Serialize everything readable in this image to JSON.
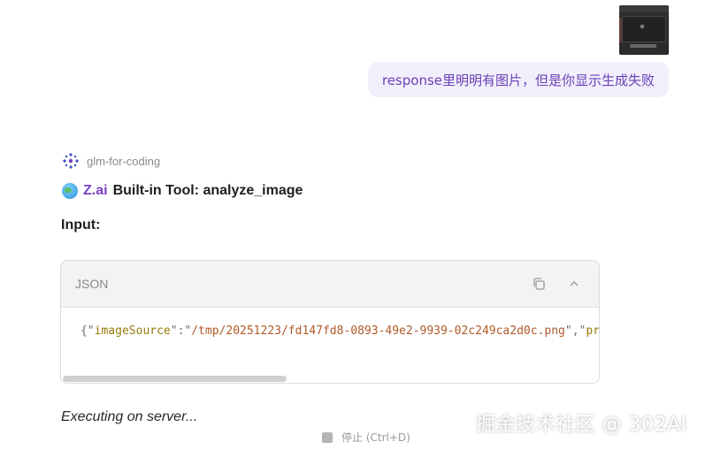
{
  "user_message": {
    "text": "response里明明有图片，但是你显示生成失败"
  },
  "assistant": {
    "model_name": "glm-for-coding",
    "tool_brand": "Z.ai",
    "tool_title": "Built-in Tool: analyze_image",
    "input_label": "Input:",
    "code_block": {
      "language": "JSON",
      "tokens": [
        {
          "t": "{\"",
          "c": "p"
        },
        {
          "t": "imageSource",
          "c": "k"
        },
        {
          "t": "\":\"",
          "c": "p"
        },
        {
          "t": "/tmp/20251223/fd147fd8-0893-49e2-9939-02c249ca2d0c.png",
          "c": "s"
        },
        {
          "t": "\",\"",
          "c": "p"
        },
        {
          "t": "pro",
          "c": "k"
        }
      ]
    },
    "status_text": "Executing on server..."
  },
  "stop_button": {
    "label": "停止 (Ctrl+D)"
  },
  "watermark": "掘金技术社区 @ 302AI",
  "icons": {
    "copy": "copy-icon",
    "collapse": "chevron-up-icon",
    "model": "zai-model-icon",
    "globe": "globe-icon",
    "stop": "stop-icon"
  },
  "colors": {
    "brand_purple": "#7a3fc6",
    "user_bubble_bg": "#f1effc",
    "user_bubble_text": "#6b3fb5"
  }
}
